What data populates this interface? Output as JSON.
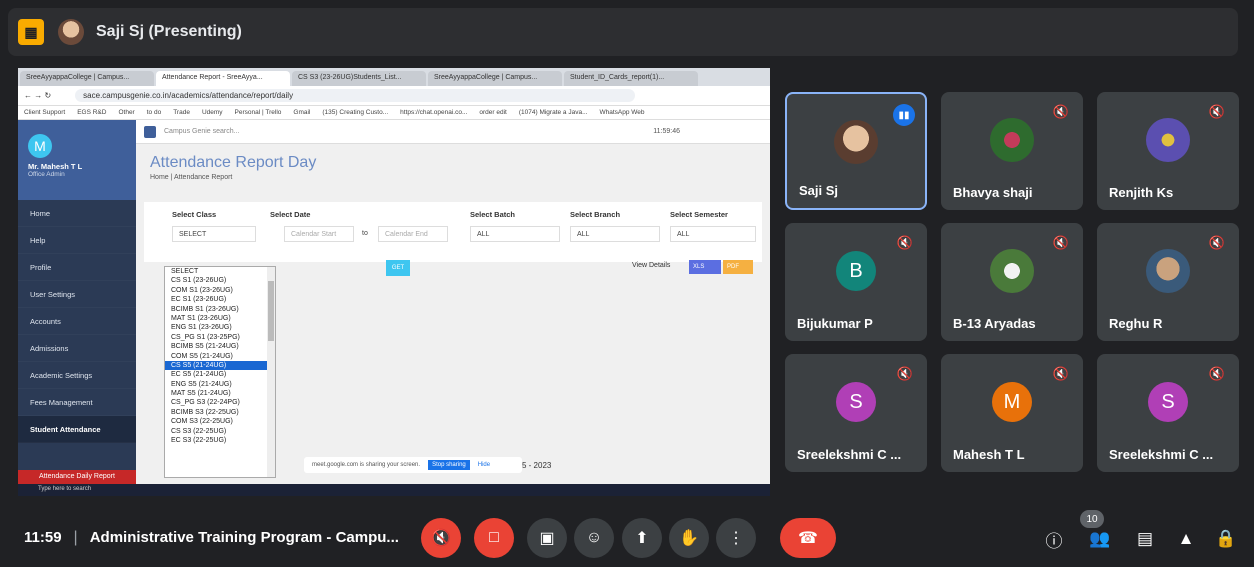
{
  "topbar": {
    "presenter_title": "Saji Sj (Presenting)"
  },
  "browser": {
    "tabs": [
      "SreeAyyappaCollege | Campus...",
      "Attendance Report - SreeAyya...",
      "CS S3 (23-26UG)Students_List...",
      "SreeAyyappaCollege | Campus...",
      "Student_ID_Cards_report(1)..."
    ],
    "url": "sace.campusgenie.co.in/academics/attendance/report/daily",
    "bookmarks": [
      "Client Support",
      "EGS R&D",
      "Other",
      "to do",
      "Trade",
      "Udemy",
      "Personal | Trello",
      "Gmail",
      "(135) Creating Custo...",
      "https://chat.openai.co...",
      "order edit",
      "(1074) Migrate a Java...",
      "WhatsApp Web"
    ]
  },
  "app": {
    "search_placeholder": "Campus Genie search...",
    "time": "11:59:46",
    "user": {
      "initial": "M",
      "name": "Mr. Mahesh T L",
      "role": "Office Admin"
    },
    "sidebar": [
      "Home",
      "Help",
      "Profile",
      "User Settings",
      "Accounts",
      "Admissions",
      "Academic Settings",
      "Fees Management",
      "Student Attendance"
    ],
    "sidebar_active": "Student Attendance",
    "sidebar_sub": "Attendance Daily Report",
    "title": "Attendance Report Day",
    "breadcrumb": "Home  |  Attendance Report",
    "filters": {
      "class_label": "Select Class",
      "class_value": "SELECT",
      "date_label": "Select Date",
      "date_start": "Calendar Start",
      "date_to": "to",
      "date_end": "Calendar End",
      "batch_label": "Select Batch",
      "batch_value": "ALL",
      "branch_label": "Select Branch",
      "branch_value": "ALL",
      "semester_label": "Select Semester",
      "semester_value": "ALL"
    },
    "get_label": "GET",
    "view_details": "View Details",
    "xls_label": "XLS",
    "pdf_label": "PDF",
    "class_options": [
      "SELECT",
      "CS S1 (23-26UG)",
      "COM S1 (23-26UG)",
      "EC S1 (23-26UG)",
      "BCIMB S1 (23-26UG)",
      "MAT S1 (23-26UG)",
      "ENG S1 (23-26UG)",
      "CS_PG S1 (23-25PG)",
      "BCIMB S5 (21-24UG)",
      "COM S5 (21-24UG)",
      "CS S5 (21-24UG)",
      "EC S5 (21-24UG)",
      "ENG S5 (21-24UG)",
      "MAT S5 (21-24UG)",
      "CS_PG S3 (22-24PG)",
      "BCIMB S3 (22-25UG)",
      "COM S3 (22-25UG)",
      "CS S3 (22-25UG)",
      "EC S3 (22-25UG)"
    ],
    "selected_option": "CS S5 (21-24UG)",
    "share_notice": "meet.google.com is sharing your screen.",
    "stop_sharing": "Stop sharing",
    "hide": "Hide",
    "year_text": "5 - 2023",
    "taskbar_search": "Type here to search"
  },
  "participants": [
    {
      "name": "Saji Sj",
      "type": "photo",
      "speaking": true,
      "muted": false
    },
    {
      "name": "Bhavya shaji",
      "type": "photo",
      "muted": true
    },
    {
      "name": "Renjith Ks",
      "type": "photo",
      "muted": true
    },
    {
      "name": "Bijukumar P",
      "type": "letter",
      "letter": "B",
      "color": "#12857a",
      "muted": true
    },
    {
      "name": "B-13 Aryadas",
      "type": "photo",
      "muted": true
    },
    {
      "name": "Reghu R",
      "type": "photo",
      "muted": true
    },
    {
      "name": "Sreelekshmi C ...",
      "type": "letter",
      "letter": "S",
      "color": "#b03fb6",
      "muted": true
    },
    {
      "name": "Mahesh T L",
      "type": "letter",
      "letter": "M",
      "color": "#e8710a",
      "muted": true
    },
    {
      "name": "Sreelekshmi C ...",
      "type": "letter",
      "letter": "S",
      "color": "#b03fb6",
      "muted": true
    }
  ],
  "bottombar": {
    "time": "11:59",
    "separator": "|",
    "meeting_title": "Administrative Training Program - Campu...",
    "people_count": "10"
  },
  "colors": {
    "background": "#202124",
    "tile": "#3c4043",
    "danger": "#ea4335",
    "accent": "#8ab4f8"
  }
}
